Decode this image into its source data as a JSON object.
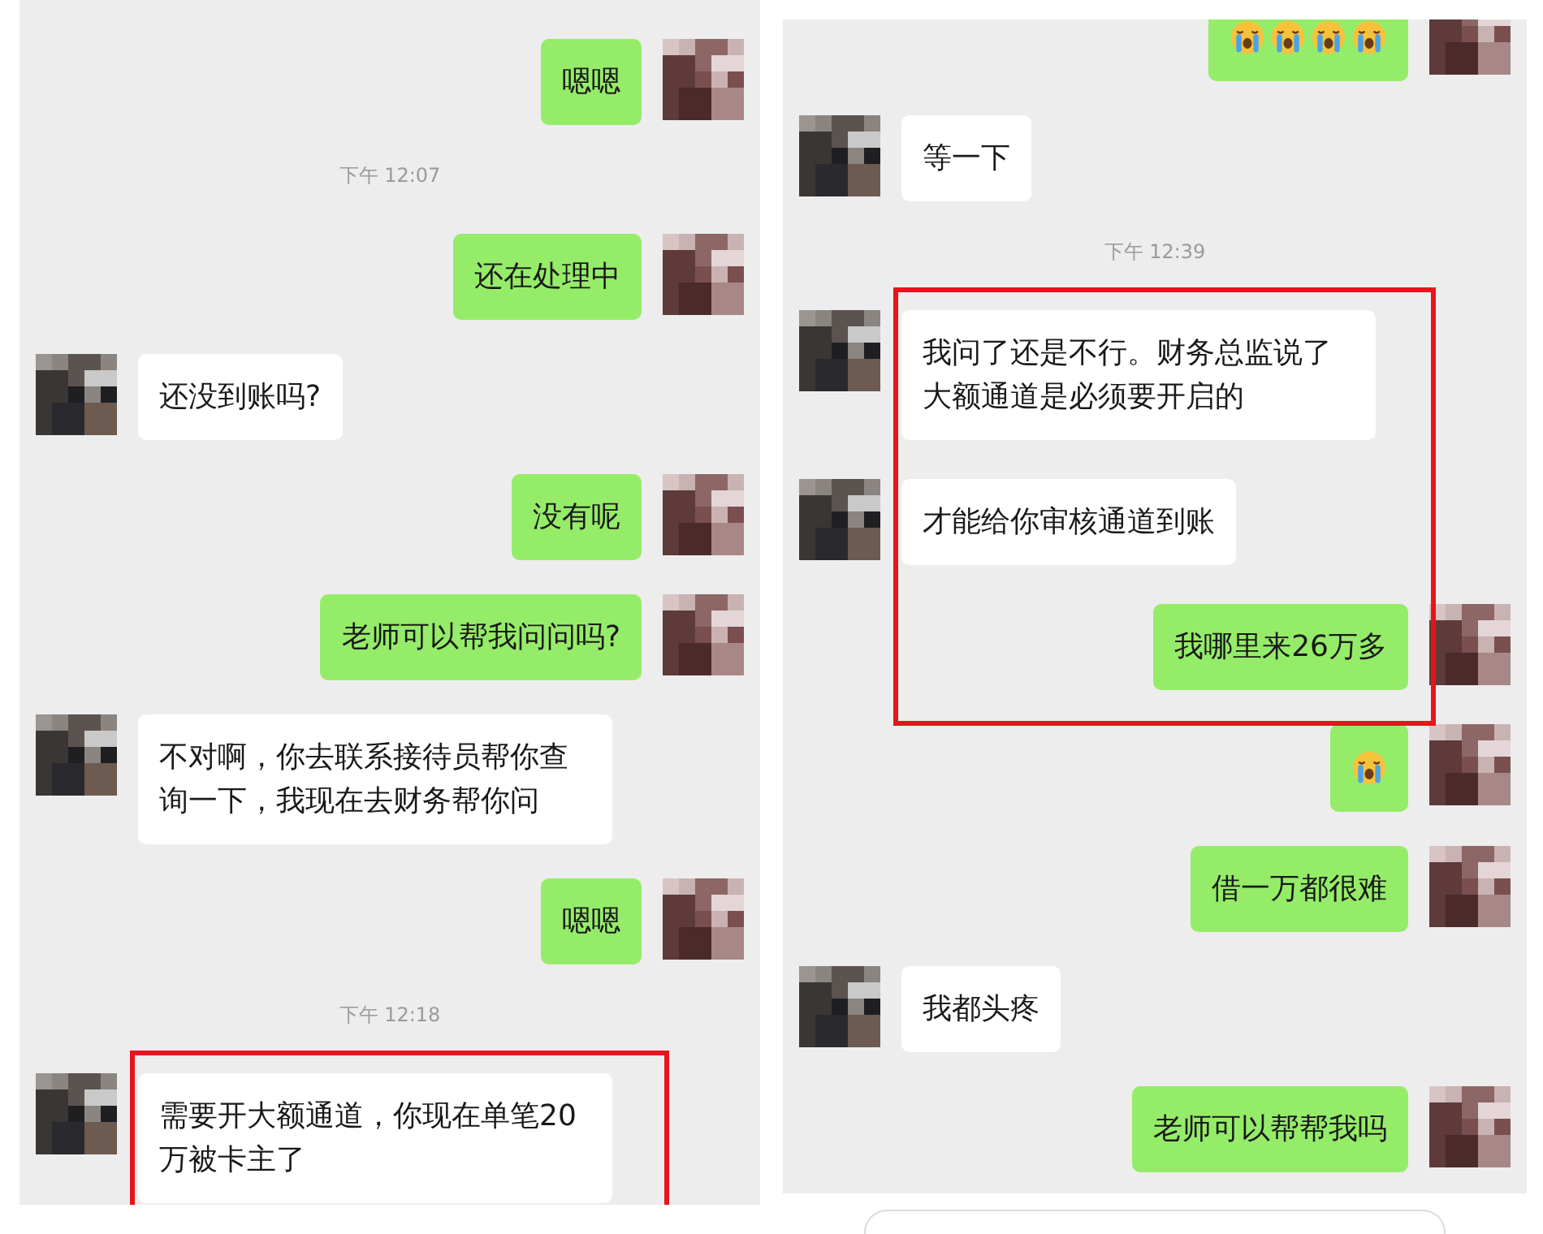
{
  "panels": [
    {
      "messages": [
        {
          "kind": "text",
          "outgoing": true,
          "text": "嗯嗯",
          "highlighted": false
        },
        {
          "kind": "time",
          "text": "下午 12:07"
        },
        {
          "kind": "text",
          "outgoing": true,
          "text": "还在处理中",
          "highlighted": false
        },
        {
          "kind": "text",
          "outgoing": false,
          "text": "还没到账吗?",
          "highlighted": false
        },
        {
          "kind": "text",
          "outgoing": true,
          "text": "没有呢",
          "highlighted": false
        },
        {
          "kind": "text",
          "outgoing": true,
          "text": "老师可以帮我问问吗?",
          "highlighted": false
        },
        {
          "kind": "text",
          "outgoing": false,
          "text": "不对啊，你去联系接待员帮你查询一下，我现在去财务帮你问",
          "highlighted": false
        },
        {
          "kind": "text",
          "outgoing": true,
          "text": "嗯嗯",
          "highlighted": false
        },
        {
          "kind": "time",
          "text": "下午 12:18"
        },
        {
          "kind": "text",
          "outgoing": false,
          "text": "需要开大额通道，你现在单笔20万被卡主了",
          "highlighted": true
        }
      ]
    },
    {
      "messages": [
        {
          "kind": "emoji",
          "outgoing": true,
          "emojis": [
            {
              "kind": "crying-face"
            },
            {
              "kind": "crying-face"
            },
            {
              "kind": "crying-face"
            },
            {
              "kind": "crying-face"
            }
          ],
          "highlighted": false
        },
        {
          "kind": "text",
          "outgoing": false,
          "text": "等一下",
          "highlighted": false
        },
        {
          "kind": "time",
          "text": "下午 12:39"
        },
        {
          "kind": "text",
          "outgoing": false,
          "text": "我问了还是不行。财务总监说了大额通道是必须要开启的",
          "highlighted": true
        },
        {
          "kind": "text",
          "outgoing": false,
          "text": "才能给你审核通道到账",
          "highlighted": true
        },
        {
          "kind": "text",
          "outgoing": true,
          "text": "我哪里来26万多",
          "highlighted": true
        },
        {
          "kind": "emoji",
          "outgoing": true,
          "emojis": [
            {
              "kind": "crying-face"
            }
          ],
          "highlighted": false
        },
        {
          "kind": "text",
          "outgoing": true,
          "text": "借一万都很难",
          "highlighted": false
        },
        {
          "kind": "text",
          "outgoing": false,
          "text": "我都头疼",
          "highlighted": false
        },
        {
          "kind": "text",
          "outgoing": true,
          "text": "老师可以帮帮我吗",
          "highlighted": false
        }
      ]
    }
  ]
}
